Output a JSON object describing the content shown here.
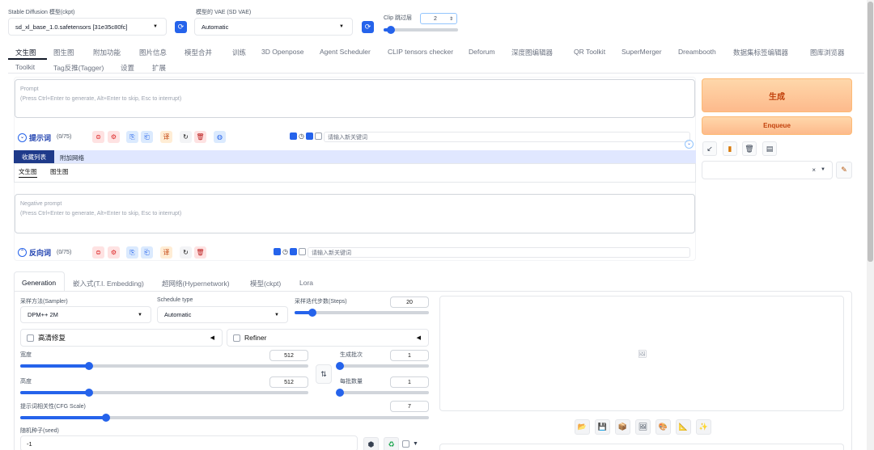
{
  "header": {
    "ckpt_label": "Stable Diffusion 模型(ckpt)",
    "ckpt_value": "sd_xl_base_1.0.safetensors [31e35c80fc]",
    "vae_label": "模型的 VAE (SD VAE)",
    "vae_value": "Automatic",
    "clip_label": "Clip 跳过层",
    "clip_value": "2",
    "refresh_icon": "refresh-icon"
  },
  "tabs_row1": [
    "文生图",
    "图生图",
    "附加功能",
    "图片信息",
    "模型合并",
    "训练",
    "3D Openpose",
    "Agent Scheduler",
    "CLIP tensors checker",
    "Deforum",
    "深度图编辑器",
    "QR Toolkit",
    "SuperMerger",
    "Dreambooth",
    "数据集标签编辑器",
    "图库浏览器"
  ],
  "tabs_row2": [
    "Toolkit",
    "Tag反推(Tagger)",
    "设置",
    "扩展"
  ],
  "prompt": {
    "label": "Prompt",
    "placeholder": "(Press Ctrl+Enter to generate, Alt+Enter to skip, Esc to interrupt)",
    "section_title": "提示词",
    "count": "(0/75)",
    "keyword_placeholder": "请输入新关键词"
  },
  "collection": {
    "tab_favorites": "收藏列表",
    "tab_extra": "附加网络",
    "subtab_txt2img": "文生图",
    "subtab_img2img": "图生图"
  },
  "negative": {
    "label": "Negative prompt",
    "placeholder": "(Press Ctrl+Enter to generate, Alt+Enter to skip, Esc to interrupt)",
    "section_title": "反向词",
    "count": "(0/75)",
    "keyword_placeholder": "请输入新关键词"
  },
  "actions": {
    "generate": "生成",
    "enqueue": "Enqueue",
    "styles_clear": "×"
  },
  "gen_tabs": [
    "Generation",
    "嵌入式(T.I. Embedding)",
    "超网络(Hypernetwork)",
    "模型(ckpt)",
    "Lora"
  ],
  "params": {
    "sampler_label": "采样方法(Sampler)",
    "sampler_value": "DPM++ 2M",
    "schedule_label": "Schedule type",
    "schedule_value": "Automatic",
    "steps_label": "采样迭代步数(Steps)",
    "steps_value": "20",
    "steps_fraction": 0.13,
    "hires_label": "高清修复",
    "refiner_label": "Refiner",
    "width_label": "宽度",
    "width_value": "512",
    "width_fraction": 0.24,
    "height_label": "高度",
    "height_value": "512",
    "height_fraction": 0.24,
    "batch_count_label": "生成批次",
    "batch_count_value": "1",
    "batch_count_fraction": 0.0,
    "batch_size_label": "每批数量",
    "batch_size_value": "1",
    "batch_size_fraction": 0.0,
    "cfg_label": "提示词相关性(CFG Scale)",
    "cfg_value": "7",
    "cfg_fraction": 0.21,
    "seed_label": "随机种子(seed)",
    "seed_value": "-1",
    "swap_icon": "⇅"
  },
  "output_tools": [
    "folder-icon",
    "save-icon",
    "zip-icon",
    "image-icon",
    "palette-icon",
    "ruler-icon",
    "sparkle-icon"
  ],
  "colors": {
    "accent": "#2563eb",
    "generate_bg": "#fdba8c",
    "generate_text": "#c2410c"
  }
}
